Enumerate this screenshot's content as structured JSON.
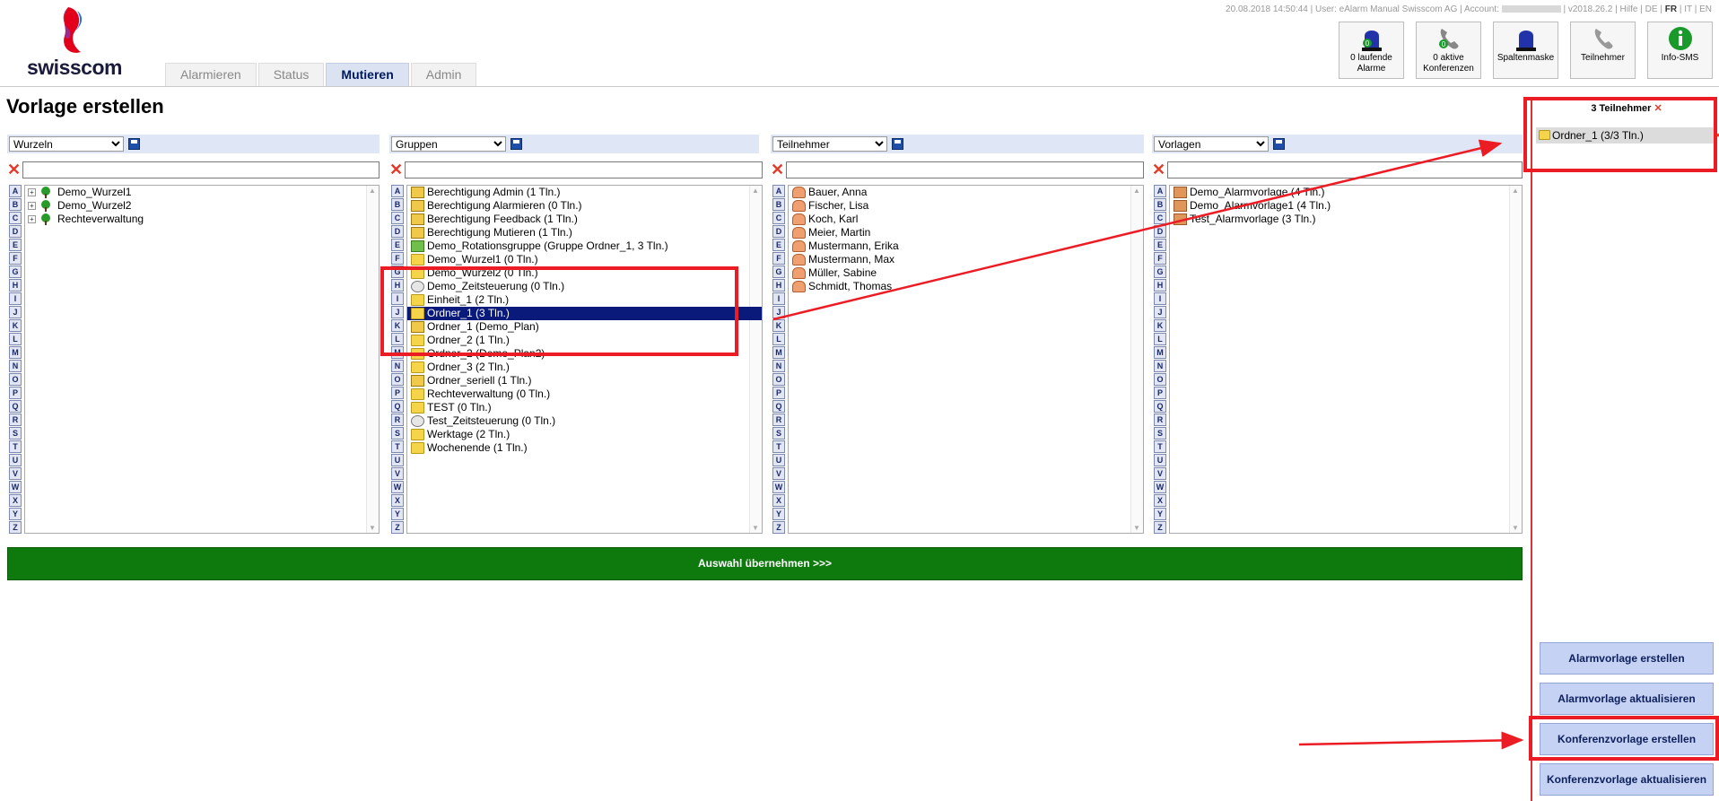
{
  "brand": "swisscom",
  "tabs": [
    {
      "label": "Alarmieren"
    },
    {
      "label": "Status"
    },
    {
      "label": "Mutieren"
    },
    {
      "label": "Admin"
    }
  ],
  "meta": {
    "datetime": "20.08.2018 14:50:44",
    "user": "User: eAlarm Manual Swisscom AG",
    "account": "Account:",
    "version": "v2018.26.2",
    "help": "Hilfe",
    "langs": [
      "DE",
      "FR",
      "IT",
      "EN"
    ]
  },
  "header_buttons": [
    {
      "label": "0 laufende Alarme",
      "icon": "alarm-siren-icon"
    },
    {
      "label": "0 aktive Konferenzen",
      "icon": "conference-phone-icon"
    },
    {
      "label": "Spaltenmaske",
      "icon": "siren-icon"
    },
    {
      "label": "Teilnehmer",
      "icon": "phone-icon"
    },
    {
      "label": "Info-SMS",
      "icon": "info-icon"
    }
  ],
  "page_title": "Vorlage erstellen",
  "az_letters": [
    "A",
    "B",
    "C",
    "D",
    "E",
    "F",
    "G",
    "H",
    "I",
    "J",
    "K",
    "L",
    "M",
    "N",
    "O",
    "P",
    "Q",
    "R",
    "S",
    "T",
    "U",
    "V",
    "W",
    "X",
    "Y",
    "Z"
  ],
  "columns": {
    "wurzeln": {
      "select": "Wurzeln",
      "items": [
        {
          "label": "Demo_Wurzel1"
        },
        {
          "label": "Demo_Wurzel2"
        },
        {
          "label": "Rechteverwaltung"
        }
      ]
    },
    "gruppen": {
      "select": "Gruppen",
      "items": [
        {
          "label": "Berechtigung Admin (1 Tln.)",
          "icon": "key"
        },
        {
          "label": "Berechtigung Alarmieren (0 Tln.)",
          "icon": "key"
        },
        {
          "label": "Berechtigung Feedback (1 Tln.)",
          "icon": "key"
        },
        {
          "label": "Berechtigung Mutieren (1 Tln.)",
          "icon": "key"
        },
        {
          "label": "Demo_Rotationsgruppe (Gruppe Ordner_1, 3 Tln.)",
          "icon": "rot"
        },
        {
          "label": "Demo_Wurzel1 (0 Tln.)",
          "icon": "folder"
        },
        {
          "label": "Demo_Wurzel2 (0 Tln.)",
          "icon": "folder"
        },
        {
          "label": "Demo_Zeitsteuerung (0 Tln.)",
          "icon": "clock"
        },
        {
          "label": "Einheit_1 (2 Tln.)",
          "icon": "folder"
        },
        {
          "label": "Ordner_1 (3 Tln.)",
          "icon": "folder",
          "selected": true
        },
        {
          "label": "Ordner_1 (Demo_Plan)",
          "icon": "key"
        },
        {
          "label": "Ordner_2 (1 Tln.)",
          "icon": "folder"
        },
        {
          "label": "Ordner_2 (Demo_Plan2)",
          "icon": "folder"
        },
        {
          "label": "Ordner_3 (2 Tln.)",
          "icon": "folder"
        },
        {
          "label": "Ordner_seriell (1 Tln.)",
          "icon": "key"
        },
        {
          "label": "Rechteverwaltung (0 Tln.)",
          "icon": "folder"
        },
        {
          "label": "TEST (0 Tln.)",
          "icon": "folder"
        },
        {
          "label": "Test_Zeitsteuerung (0 Tln.)",
          "icon": "clock"
        },
        {
          "label": "Werktage (2 Tln.)",
          "icon": "folder"
        },
        {
          "label": "Wochenende (1 Tln.)",
          "icon": "folder"
        }
      ]
    },
    "teilnehmer": {
      "select": "Teilnehmer",
      "items": [
        {
          "label": "Bauer, Anna"
        },
        {
          "label": "Fischer, Lisa"
        },
        {
          "label": "Koch, Karl"
        },
        {
          "label": "Meier, Martin"
        },
        {
          "label": "Mustermann, Erika"
        },
        {
          "label": "Mustermann, Max"
        },
        {
          "label": "Müller, Sabine"
        },
        {
          "label": "Schmidt, Thomas"
        }
      ]
    },
    "vorlagen": {
      "select": "Vorlagen",
      "items": [
        {
          "label": "Demo_Alarmvorlage (4 Tln.)"
        },
        {
          "label": "Demo_Alarmvorlage1 (4 Tln.)"
        },
        {
          "label": "Test_Alarmvorlage (3 Tln.)"
        }
      ]
    }
  },
  "takeover_label": "Auswahl übernehmen >>>",
  "right_panel": {
    "title": "3 Teilnehmer",
    "item": "Ordner_1 (3/3 Tln.)"
  },
  "right_buttons": [
    "Alarmvorlage erstellen",
    "Alarmvorlage aktualisieren",
    "Konferenzvorlage erstellen",
    "Konferenzvorlage aktualisieren"
  ]
}
